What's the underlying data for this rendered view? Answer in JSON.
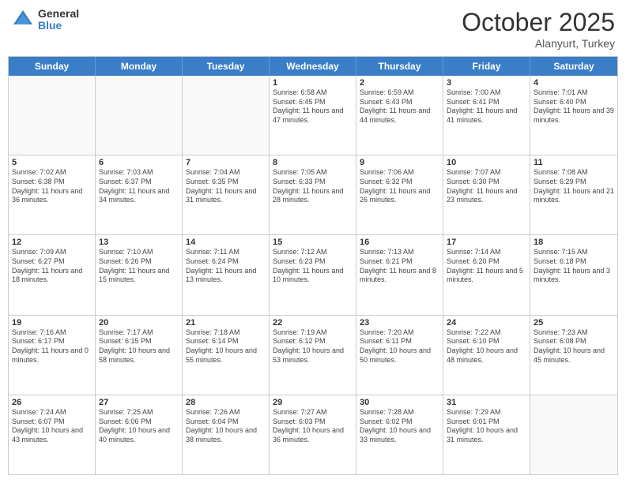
{
  "header": {
    "logo_general": "General",
    "logo_blue": "Blue",
    "month": "October 2025",
    "location": "Alanyurt, Turkey"
  },
  "days": [
    "Sunday",
    "Monday",
    "Tuesday",
    "Wednesday",
    "Thursday",
    "Friday",
    "Saturday"
  ],
  "weeks": [
    [
      {
        "day": "",
        "info": ""
      },
      {
        "day": "",
        "info": ""
      },
      {
        "day": "",
        "info": ""
      },
      {
        "day": "1",
        "info": "Sunrise: 6:58 AM\nSunset: 6:45 PM\nDaylight: 11 hours and 47 minutes."
      },
      {
        "day": "2",
        "info": "Sunrise: 6:59 AM\nSunset: 6:43 PM\nDaylight: 11 hours and 44 minutes."
      },
      {
        "day": "3",
        "info": "Sunrise: 7:00 AM\nSunset: 6:41 PM\nDaylight: 11 hours and 41 minutes."
      },
      {
        "day": "4",
        "info": "Sunrise: 7:01 AM\nSunset: 6:40 PM\nDaylight: 11 hours and 39 minutes."
      }
    ],
    [
      {
        "day": "5",
        "info": "Sunrise: 7:02 AM\nSunset: 6:38 PM\nDaylight: 11 hours and 36 minutes."
      },
      {
        "day": "6",
        "info": "Sunrise: 7:03 AM\nSunset: 6:37 PM\nDaylight: 11 hours and 34 minutes."
      },
      {
        "day": "7",
        "info": "Sunrise: 7:04 AM\nSunset: 6:35 PM\nDaylight: 11 hours and 31 minutes."
      },
      {
        "day": "8",
        "info": "Sunrise: 7:05 AM\nSunset: 6:33 PM\nDaylight: 11 hours and 28 minutes."
      },
      {
        "day": "9",
        "info": "Sunrise: 7:06 AM\nSunset: 6:32 PM\nDaylight: 11 hours and 26 minutes."
      },
      {
        "day": "10",
        "info": "Sunrise: 7:07 AM\nSunset: 6:30 PM\nDaylight: 11 hours and 23 minutes."
      },
      {
        "day": "11",
        "info": "Sunrise: 7:08 AM\nSunset: 6:29 PM\nDaylight: 11 hours and 21 minutes."
      }
    ],
    [
      {
        "day": "12",
        "info": "Sunrise: 7:09 AM\nSunset: 6:27 PM\nDaylight: 11 hours and 18 minutes."
      },
      {
        "day": "13",
        "info": "Sunrise: 7:10 AM\nSunset: 6:26 PM\nDaylight: 11 hours and 15 minutes."
      },
      {
        "day": "14",
        "info": "Sunrise: 7:11 AM\nSunset: 6:24 PM\nDaylight: 11 hours and 13 minutes."
      },
      {
        "day": "15",
        "info": "Sunrise: 7:12 AM\nSunset: 6:23 PM\nDaylight: 11 hours and 10 minutes."
      },
      {
        "day": "16",
        "info": "Sunrise: 7:13 AM\nSunset: 6:21 PM\nDaylight: 11 hours and 8 minutes."
      },
      {
        "day": "17",
        "info": "Sunrise: 7:14 AM\nSunset: 6:20 PM\nDaylight: 11 hours and 5 minutes."
      },
      {
        "day": "18",
        "info": "Sunrise: 7:15 AM\nSunset: 6:18 PM\nDaylight: 11 hours and 3 minutes."
      }
    ],
    [
      {
        "day": "19",
        "info": "Sunrise: 7:16 AM\nSunset: 6:17 PM\nDaylight: 11 hours and 0 minutes."
      },
      {
        "day": "20",
        "info": "Sunrise: 7:17 AM\nSunset: 6:15 PM\nDaylight: 10 hours and 58 minutes."
      },
      {
        "day": "21",
        "info": "Sunrise: 7:18 AM\nSunset: 6:14 PM\nDaylight: 10 hours and 55 minutes."
      },
      {
        "day": "22",
        "info": "Sunrise: 7:19 AM\nSunset: 6:12 PM\nDaylight: 10 hours and 53 minutes."
      },
      {
        "day": "23",
        "info": "Sunrise: 7:20 AM\nSunset: 6:11 PM\nDaylight: 10 hours and 50 minutes."
      },
      {
        "day": "24",
        "info": "Sunrise: 7:22 AM\nSunset: 6:10 PM\nDaylight: 10 hours and 48 minutes."
      },
      {
        "day": "25",
        "info": "Sunrise: 7:23 AM\nSunset: 6:08 PM\nDaylight: 10 hours and 45 minutes."
      }
    ],
    [
      {
        "day": "26",
        "info": "Sunrise: 7:24 AM\nSunset: 6:07 PM\nDaylight: 10 hours and 43 minutes."
      },
      {
        "day": "27",
        "info": "Sunrise: 7:25 AM\nSunset: 6:06 PM\nDaylight: 10 hours and 40 minutes."
      },
      {
        "day": "28",
        "info": "Sunrise: 7:26 AM\nSunset: 6:04 PM\nDaylight: 10 hours and 38 minutes."
      },
      {
        "day": "29",
        "info": "Sunrise: 7:27 AM\nSunset: 6:03 PM\nDaylight: 10 hours and 36 minutes."
      },
      {
        "day": "30",
        "info": "Sunrise: 7:28 AM\nSunset: 6:02 PM\nDaylight: 10 hours and 33 minutes."
      },
      {
        "day": "31",
        "info": "Sunrise: 7:29 AM\nSunset: 6:01 PM\nDaylight: 10 hours and 31 minutes."
      },
      {
        "day": "",
        "info": ""
      }
    ]
  ]
}
